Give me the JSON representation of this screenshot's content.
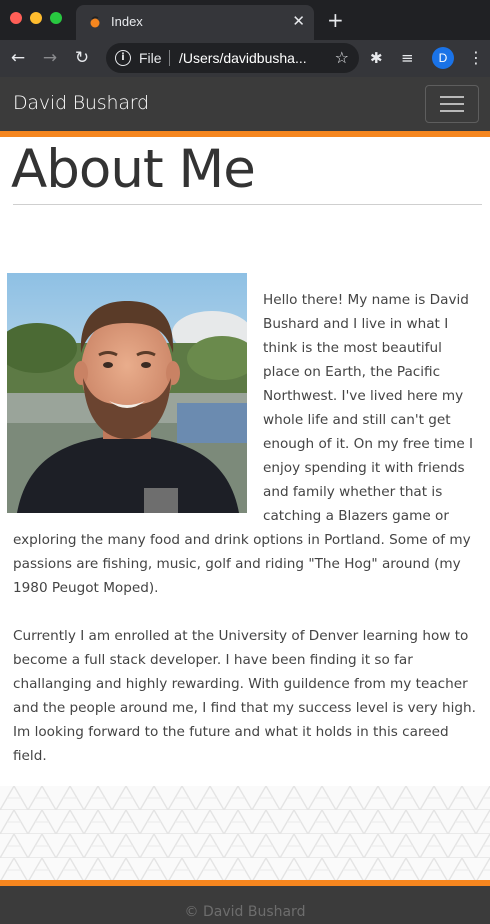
{
  "browser": {
    "tab_title": "Index",
    "tab_close": "✕",
    "new_tab": "+",
    "back": "←",
    "forward": "→",
    "reload": "↻",
    "info": "i",
    "scheme_label": "File",
    "url": "/Users/davidbusha...",
    "bookmark": "☆",
    "extensions": "✱",
    "media": "≡",
    "profile_initial": "D",
    "menu": "⋮",
    "accent": "#1a73e8"
  },
  "nav": {
    "brand": "David Bushard",
    "menu_icon": "hamburger-icon"
  },
  "about": {
    "title": "About Me",
    "paragraphs": [
      "Hello there! My name is David Bushard and I live in what I think is the most beautiful place on Earth, the Pacific Northwest. I've lived here my whole life and still can't get enough of it. On my free time I enjoy spending it with friends and family whether that is catching a Blazers game or exploring the many food and drink options in Portland. Some of my passions are fishing, music, golf and riding \"The Hog\" around (my 1980 Peugot Moped).",
      "Currently I am enrolled at the University of Denver learning how to become a full stack developer. I have been finding it so far challanging and highly rewarding. With guildence from my teacher and the people around me, I find that my success level is very high. Im looking forward to the future and what it holds in this careed field."
    ]
  },
  "footer": {
    "text": "© David Bushard"
  },
  "colors": {
    "accent": "#f5861f",
    "nav_bg": "#3b3b3b"
  }
}
